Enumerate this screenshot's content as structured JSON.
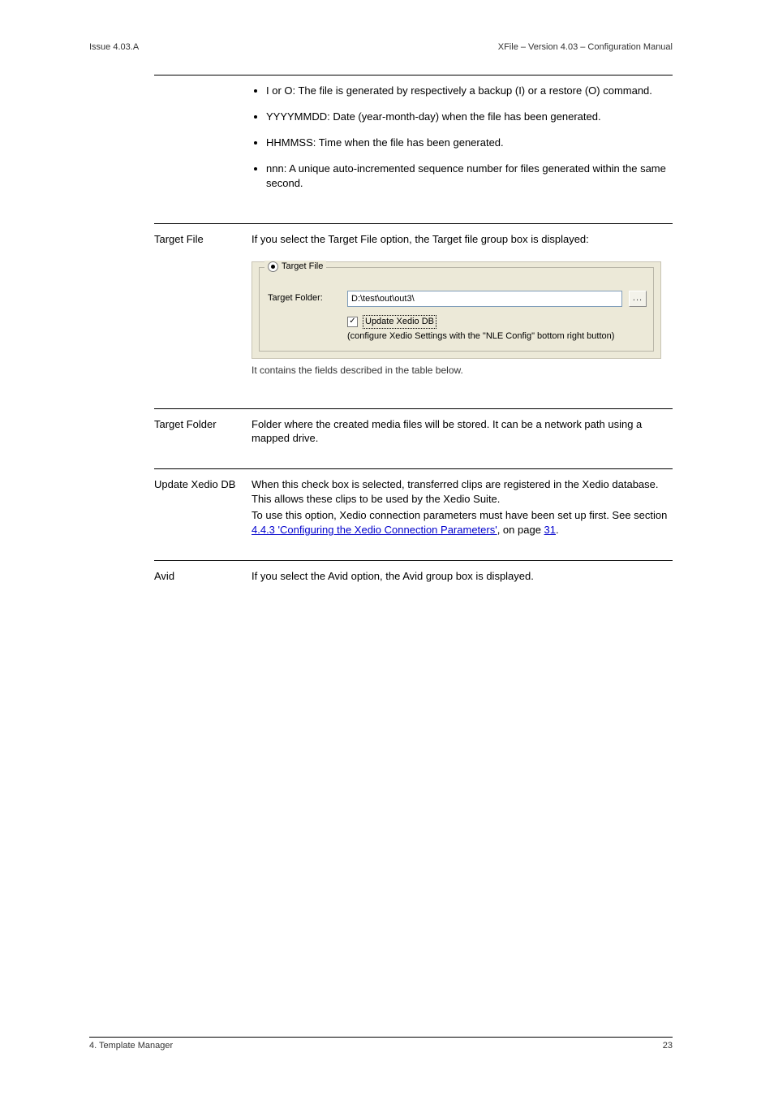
{
  "header": {
    "left": "Issue 4.03.A",
    "right": "XFile – Version 4.03 – Configuration Manual"
  },
  "sections": [
    {
      "label": "",
      "intro": "",
      "bullets": [
        "I or O: The file is generated by respectively a backup (I) or a restore (O) command.",
        "YYYYMMDD: Date (year-month-day) when the file has been generated.",
        "HHMMSS: Time when the file has been generated.",
        "nnn: A unique auto-incremented sequence number for files generated within the same second."
      ],
      "screenshot": null
    },
    {
      "label": "Target File",
      "intro": "If you select the Target File option, the Target file group box is displayed:",
      "bullets": [],
      "screenshot": {
        "radio_label": "Target File",
        "target_folder_label": "Target Folder:",
        "target_folder_value": "D:\\test\\out\\out3\\",
        "browse_label": "...",
        "checkbox_label": "Update Xedio DB",
        "checkbox_checked": true,
        "hint": "(configure Xedio Settings with the \"NLE Config\" bottom right button)"
      },
      "caption": "It contains the fields described in the table below."
    },
    {
      "label": "Target Folder",
      "intro": "",
      "body": "Folder where the created media files will be stored. It can be a network path using a mapped drive.",
      "bullets": [],
      "screenshot": null
    },
    {
      "label": "Update Xedio DB",
      "intro": "",
      "body_parts": [
        "When this check box is selected, transferred clips are registered in the Xedio database. This allows these clips to be used by the Xedio Suite.",
        "To use this option, Xedio connection parameters must have been set up first. See section ",
        "4.4.3 'Configuring the Xedio Connection Parameters'",
        ", on page ",
        "31",
        "."
      ],
      "bullets": [],
      "screenshot": null
    },
    {
      "label": "Avid",
      "intro": "If you select the Avid option, the Avid group box is displayed.",
      "body": "",
      "bullets": [],
      "screenshot": null
    }
  ],
  "footer": {
    "left": "4. Template Manager",
    "right": "23"
  }
}
